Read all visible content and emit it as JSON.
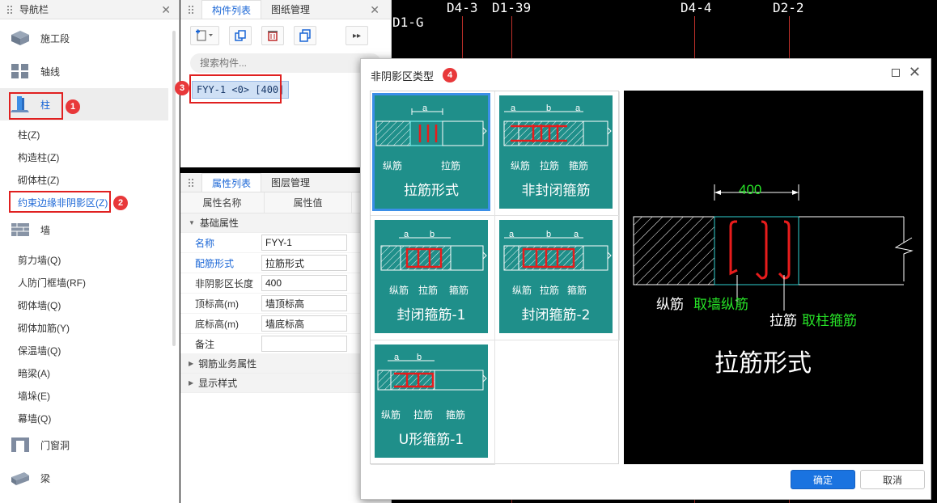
{
  "nav": {
    "title": "导航栏",
    "categories": [
      {
        "label": "施工段"
      },
      {
        "label": "轴线"
      },
      {
        "label": "柱"
      },
      {
        "label": "墙"
      },
      {
        "label": "门窗洞"
      },
      {
        "label": "梁"
      }
    ],
    "column_items": [
      "柱(Z)",
      "构造柱(Z)",
      "砌体柱(Z)",
      "约束边缘非阴影区(Z)"
    ],
    "wall_items": [
      "剪力墙(Q)",
      "人防门框墙(RF)",
      "砌体墙(Q)",
      "砌体加筋(Y)",
      "保温墙(Q)",
      "暗梁(A)",
      "墙垛(E)",
      "幕墙(Q)"
    ]
  },
  "badges": [
    "1",
    "2",
    "3",
    "4"
  ],
  "component_panel": {
    "tabs": [
      "构件列表",
      "图纸管理"
    ],
    "search_placeholder": "搜索构件...",
    "item": "FYY-1 <0> [400]"
  },
  "property_panel": {
    "tabs": [
      "属性列表",
      "图层管理"
    ],
    "headers": [
      "属性名称",
      "属性值"
    ],
    "group_basic": "基础属性",
    "rows": [
      {
        "key": "名称",
        "value": "FYY-1"
      },
      {
        "key": "配筋形式",
        "value": "拉筋形式"
      },
      {
        "key": "非阴影区长度",
        "value": "400"
      },
      {
        "key": "顶标高(m)",
        "value": "墙顶标高"
      },
      {
        "key": "底标高(m)",
        "value": "墙底标高"
      },
      {
        "key": "备注",
        "value": ""
      }
    ],
    "group_rebar": "钢筋业务属性",
    "group_display": "显示样式"
  },
  "cad": {
    "labels": [
      "D4-3",
      "D1-39",
      "D4-4",
      "D2-2",
      "D1-G"
    ]
  },
  "dialog": {
    "title": "非阴影区类型",
    "options": [
      {
        "caption": "拉筋形式",
        "labels": [
          "纵筋",
          "拉筋"
        ],
        "dims": [
          "a"
        ]
      },
      {
        "caption": "非封闭箍筋",
        "labels": [
          "纵筋",
          "拉筋",
          "箍筋"
        ],
        "dims": [
          "a",
          "b",
          "a"
        ]
      },
      {
        "caption": "封闭箍筋-1",
        "labels": [
          "纵筋",
          "拉筋",
          "箍筋"
        ],
        "dims": [
          "a",
          "b"
        ]
      },
      {
        "caption": "封闭箍筋-2",
        "labels": [
          "纵筋",
          "拉筋",
          "箍筋"
        ],
        "dims": [
          "a",
          "b",
          "a"
        ]
      },
      {
        "caption": "U形箍筋-1",
        "labels": [
          "纵筋",
          "拉筋",
          "箍筋"
        ],
        "dims": [
          "a",
          "b"
        ]
      }
    ],
    "preview": {
      "dim": "400",
      "label1_white": "纵筋",
      "label1_green": "取墙纵筋",
      "label2_white": "拉筋",
      "label2_green": "取柱箍筋",
      "caption": "拉筋形式"
    },
    "ok": "确定",
    "cancel": "取消"
  },
  "colors": {
    "teal": "#1f8f8a",
    "accent": "#1a73e0",
    "highlight": "#e02020",
    "cad_green": "#27e227"
  }
}
